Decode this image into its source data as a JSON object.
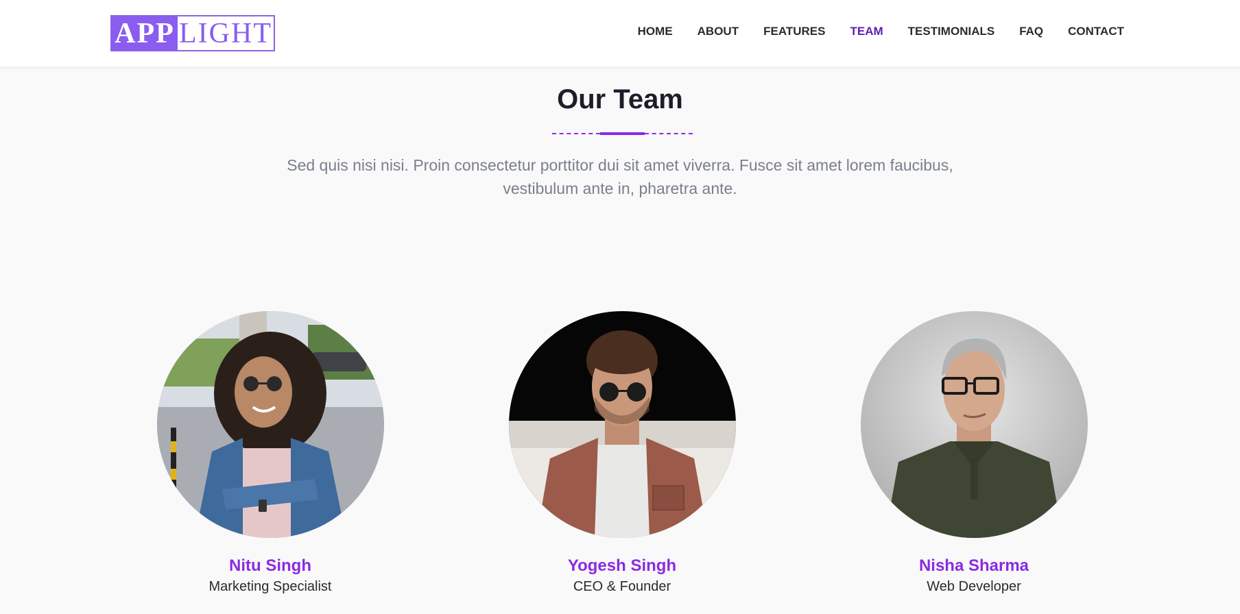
{
  "header": {
    "logo": {
      "left": "APP",
      "right": "LIGHT"
    },
    "nav": [
      {
        "label": "HOME",
        "active": false
      },
      {
        "label": "ABOUT",
        "active": false
      },
      {
        "label": "FEATURES",
        "active": false
      },
      {
        "label": "TEAM",
        "active": true
      },
      {
        "label": "TESTIMONIALS",
        "active": false
      },
      {
        "label": "FAQ",
        "active": false
      },
      {
        "label": "CONTACT",
        "active": false
      }
    ]
  },
  "section": {
    "title": "Our Team",
    "description": "Sed quis nisi nisi. Proin consectetur porttitor dui sit amet viverra. Fusce sit amet lorem faucibus, vestibulum ante in, pharetra ante."
  },
  "team": [
    {
      "name": "Nitu Singh",
      "role": "Marketing Specialist"
    },
    {
      "name": "Yogesh Singh",
      "role": "CEO & Founder"
    },
    {
      "name": "Nisha Sharma",
      "role": "Web Developer"
    }
  ],
  "colors": {
    "accent": "#8a2be2",
    "nav_active": "#5b1fb0",
    "logo_purple": "#8a5cf0"
  }
}
